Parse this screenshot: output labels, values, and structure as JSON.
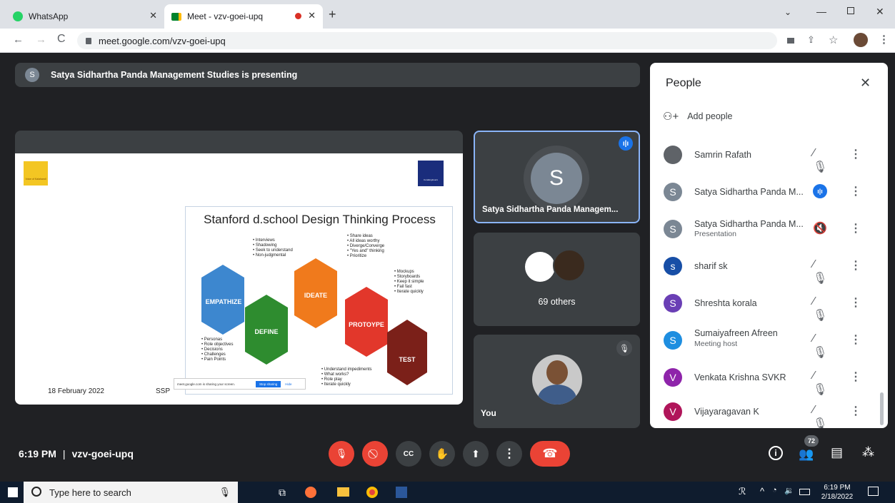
{
  "browser": {
    "tabs": [
      {
        "label": "WhatsApp",
        "active": false
      },
      {
        "label": "Meet - vzv-goei-upq",
        "active": true
      }
    ],
    "url": "meet.google.com/vzv-goei-upq"
  },
  "meet": {
    "presenting_banner": "Satya Sidhartha Panda Management Studies is presenting",
    "presenter_initial": "S",
    "slide": {
      "title": "Stanford d.school Design Thinking Process",
      "logo_left_text": "Voice of Kalahandi",
      "logo_right_text": "CoreEngineers",
      "date": "18 February 2022",
      "initials": "SSP",
      "share_notice": "meet.google.com is sharing your screen.",
      "stop_sharing": "Stop sharing",
      "hide": "Hide",
      "stages": [
        {
          "label": "Empathize",
          "color": "#3d87cf"
        },
        {
          "label": "Define",
          "color": "#2e8c2f"
        },
        {
          "label": "Ideate",
          "color": "#f07a1c"
        },
        {
          "label": "Protoype",
          "color": "#e2372b"
        },
        {
          "label": "Test",
          "color": "#7b2019"
        }
      ],
      "notes_empathize": [
        "• Interviews",
        "• Shadowing",
        "• Seek to understand",
        "• Non-judgmental"
      ],
      "notes_ideate": [
        "• Share ideas",
        "• All ideas worthy",
        "• Diverge/Converge",
        "• \"Yes and\" thinking",
        "• Prioritize"
      ],
      "notes_prototype": [
        "• Mockups",
        "• Storyboards",
        "• Keep it simple",
        "• Fail fast",
        "• Iterate quickly"
      ],
      "notes_define": [
        "• Personas",
        "• Role objectives",
        "• Decisions",
        "• Challenges",
        "• Pain Points"
      ],
      "notes_test": [
        "• Understand impediments",
        "• What works?",
        "• Role play",
        "• Iterate quickly"
      ]
    },
    "tiles": {
      "presenter_name": "Satya Sidhartha Panda Managem...",
      "presenter_initial": "S",
      "others": "69 others",
      "you": "You"
    },
    "footer": {
      "time": "6:19 PM",
      "separator": "|",
      "code": "vzv-goei-upq",
      "people_count": "72"
    }
  },
  "people_panel": {
    "title": "People",
    "add_people": "Add people",
    "members": [
      {
        "initial": "",
        "name": "Samrin Rafath",
        "sub": "",
        "color": "#5f6368",
        "mic": "muted"
      },
      {
        "initial": "S",
        "name": "Satya Sidhartha Panda M...",
        "sub": "",
        "color": "#7b8794",
        "mic": "speaking"
      },
      {
        "initial": "S",
        "name": "Satya Sidhartha Panda M...",
        "sub": "Presentation",
        "color": "#7b8794",
        "mic": "audio-off"
      },
      {
        "initial": "s",
        "name": "sharif sk",
        "sub": "",
        "color": "#174ea6",
        "mic": "muted"
      },
      {
        "initial": "S",
        "name": "Shreshta korala",
        "sub": "",
        "color": "#6a3fb5",
        "mic": "muted"
      },
      {
        "initial": "S",
        "name": "Sumaiyafreen Afreen",
        "sub": "Meeting host",
        "color": "#1e8ee0",
        "mic": "muted"
      },
      {
        "initial": "V",
        "name": "Venkata Krishna SVKR",
        "sub": "",
        "color": "#8e24aa",
        "mic": "muted"
      },
      {
        "initial": "V",
        "name": "Vijayaragavan K",
        "sub": "",
        "color": "#b0155a",
        "mic": "muted"
      }
    ]
  },
  "taskbar": {
    "search_placeholder": "Type here to search",
    "time": "6:19 PM",
    "date": "2/18/2022"
  },
  "colors": {
    "accent": "#8ab4f8",
    "danger": "#ea4335",
    "meet_bg": "#202124"
  }
}
